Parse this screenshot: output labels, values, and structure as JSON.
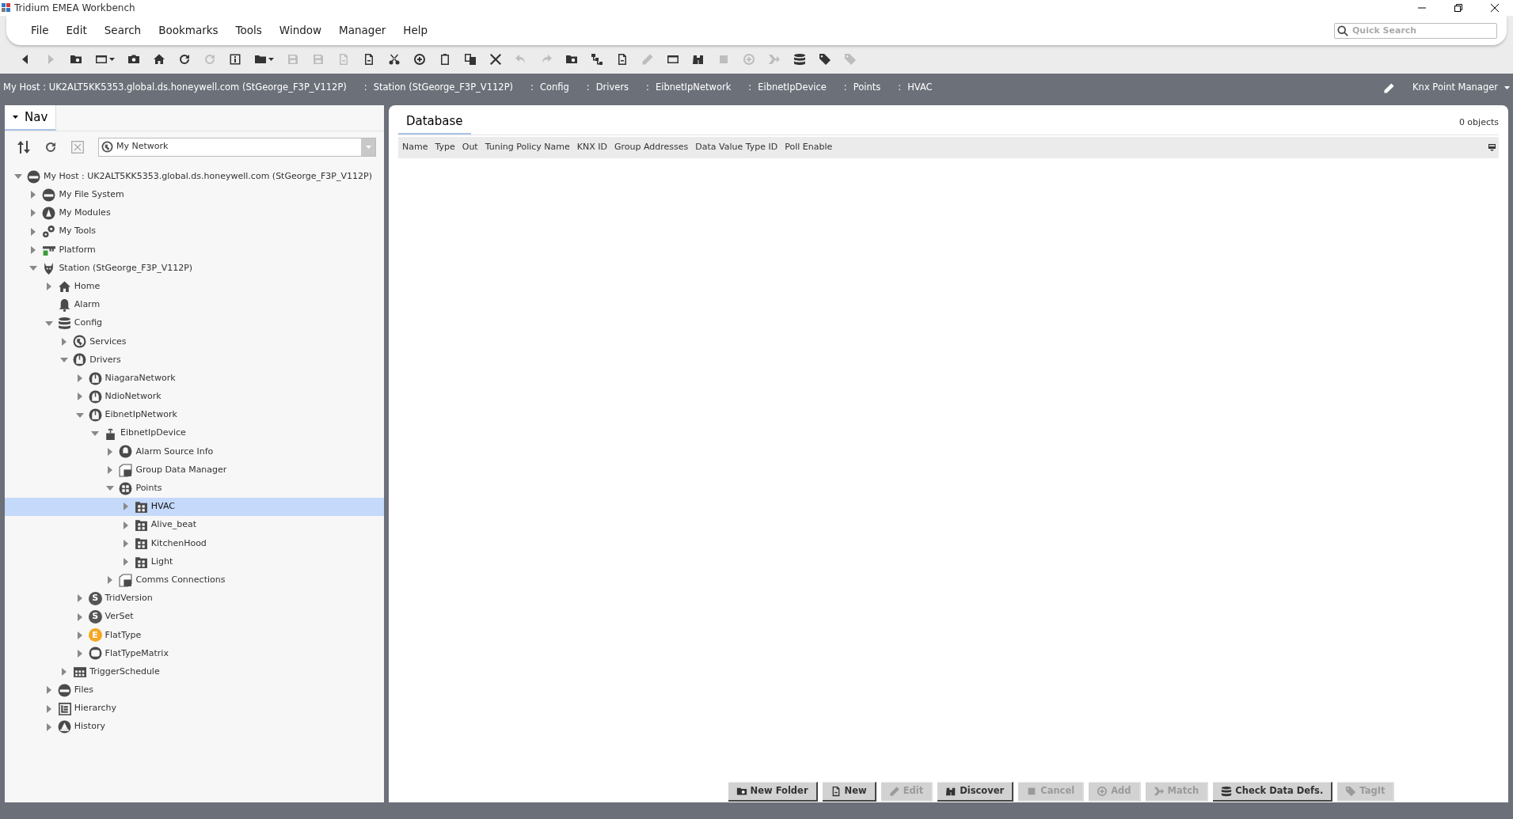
{
  "window": {
    "title": "Tridium EMEA Workbench"
  },
  "menu": [
    "File",
    "Edit",
    "Search",
    "Bookmarks",
    "Tools",
    "Window",
    "Manager",
    "Help"
  ],
  "quick_search": {
    "placeholder": "Quick Search"
  },
  "toolbar": [
    {
      "kind": "back",
      "disabled": false
    },
    {
      "kind": "forward",
      "disabled": true
    },
    {
      "kind": "folderup",
      "disabled": false
    },
    {
      "kind": "window",
      "disabled": false,
      "dropdown": true
    },
    {
      "kind": "camera",
      "disabled": false
    },
    {
      "kind": "home",
      "disabled": false
    },
    {
      "kind": "refresh",
      "disabled": false
    },
    {
      "kind": "refresh",
      "disabled": true
    },
    {
      "kind": "info",
      "disabled": false
    },
    {
      "kind": "folder",
      "disabled": false,
      "dropdown": true
    },
    {
      "kind": "save",
      "disabled": true
    },
    {
      "kind": "save",
      "disabled": true
    },
    {
      "kind": "doc",
      "disabled": true
    },
    {
      "kind": "doc",
      "disabled": false
    },
    {
      "kind": "cut",
      "disabled": false
    },
    {
      "kind": "addcircle",
      "disabled": false
    },
    {
      "kind": "clipboard",
      "disabled": false
    },
    {
      "kind": "copy",
      "disabled": false
    },
    {
      "kind": "delete",
      "disabled": false
    },
    {
      "kind": "undo",
      "disabled": true
    },
    {
      "kind": "redo",
      "disabled": true
    },
    {
      "kind": "folderup",
      "disabled": false
    },
    {
      "kind": "tree",
      "disabled": false
    },
    {
      "kind": "doc",
      "disabled": false
    },
    {
      "kind": "pencil",
      "disabled": true
    },
    {
      "kind": "window",
      "disabled": false
    },
    {
      "kind": "binoculars",
      "disabled": false
    },
    {
      "kind": "stop",
      "disabled": true
    },
    {
      "kind": "addcircle",
      "disabled": true
    },
    {
      "kind": "match",
      "disabled": true
    },
    {
      "kind": "database",
      "disabled": false
    },
    {
      "kind": "tag",
      "disabled": false
    },
    {
      "kind": "tag",
      "disabled": true
    }
  ],
  "breadcrumb": {
    "separator": ":",
    "items": [
      "My Host : UK2ALT5KK5353.global.ds.honeywell.com (StGeorge_F3P_V112P)",
      "Station (StGeorge_F3P_V112P)",
      "Config",
      "Drivers",
      "EibnetIpNetwork",
      "EibnetIpDevice",
      "Points",
      "HVAC"
    ],
    "view": "Knx Point Manager"
  },
  "nav": {
    "tab": "Nav",
    "dropdown": "My Network",
    "tree": [
      {
        "label": "My Host : UK2ALT5KK5353.global.ds.honeywell.com (StGeorge_F3P_V112P)",
        "kind": "drive",
        "expanded": true,
        "selected": false,
        "children": [
          {
            "label": "My File System",
            "kind": "drive",
            "expanded": false,
            "selected": false
          },
          {
            "label": "My Modules",
            "kind": "module",
            "expanded": false,
            "selected": false
          },
          {
            "label": "My Tools",
            "kind": "gears",
            "expanded": false,
            "selected": false
          },
          {
            "label": "Platform",
            "kind": "platform",
            "expanded": false,
            "selected": false
          },
          {
            "label": "Station (StGeorge_F3P_V112P)",
            "kind": "station",
            "expanded": true,
            "selected": false,
            "children": [
              {
                "label": "Home",
                "kind": "home",
                "expanded": false,
                "selected": false
              },
              {
                "label": "Alarm",
                "kind": "bell",
                "selected": false,
                "leaf": true
              },
              {
                "label": "Config",
                "kind": "database",
                "expanded": true,
                "selected": false,
                "children": [
                  {
                    "label": "Services",
                    "kind": "globe",
                    "expanded": false,
                    "selected": false
                  },
                  {
                    "label": "Drivers",
                    "kind": "driver",
                    "expanded": true,
                    "selected": false,
                    "children": [
                      {
                        "label": "NiagaraNetwork",
                        "kind": "driver",
                        "expanded": false,
                        "selected": false
                      },
                      {
                        "label": "NdioNetwork",
                        "kind": "driver",
                        "expanded": false,
                        "selected": false
                      },
                      {
                        "label": "EibnetIpNetwork",
                        "kind": "driver",
                        "expanded": true,
                        "selected": false,
                        "children": [
                          {
                            "label": "EibnetIpDevice",
                            "kind": "device",
                            "expanded": true,
                            "selected": false,
                            "children": [
                              {
                                "label": "Alarm Source Info",
                                "kind": "alarmsource",
                                "expanded": false,
                                "selected": false
                              },
                              {
                                "label": "Group Data Manager",
                                "kind": "cube",
                                "expanded": false,
                                "selected": false
                              },
                              {
                                "label": "Points",
                                "kind": "points",
                                "expanded": true,
                                "selected": false,
                                "children": [
                                  {
                                    "label": "HVAC",
                                    "kind": "grid",
                                    "expanded": false,
                                    "selected": true
                                  },
                                  {
                                    "label": "Alive_beat",
                                    "kind": "grid",
                                    "expanded": false,
                                    "selected": false
                                  },
                                  {
                                    "label": "KitchenHood",
                                    "kind": "grid",
                                    "expanded": false,
                                    "selected": false
                                  },
                                  {
                                    "label": "Light",
                                    "kind": "grid",
                                    "expanded": false,
                                    "selected": false
                                  }
                                ]
                              },
                              {
                                "label": "Comms Connections",
                                "kind": "cube",
                                "expanded": false,
                                "selected": false
                              }
                            ]
                          }
                        ]
                      },
                      {
                        "label": "TridVersion",
                        "kind": "letter",
                        "letter": "S",
                        "color": "#555555",
                        "expanded": false,
                        "selected": false
                      },
                      {
                        "label": "VerSet",
                        "kind": "letter",
                        "letter": "S",
                        "color": "#555555",
                        "expanded": false,
                        "selected": false
                      },
                      {
                        "label": "FlatType",
                        "kind": "letter",
                        "letter": "E",
                        "color": "#f5a623",
                        "expanded": false,
                        "selected": false
                      },
                      {
                        "label": "FlatTypeMatrix",
                        "kind": "ring",
                        "expanded": false,
                        "selected": false
                      }
                    ]
                  },
                  {
                    "label": "TriggerSchedule",
                    "kind": "schedule",
                    "expanded": false,
                    "selected": false
                  }
                ]
              },
              {
                "label": "Files",
                "kind": "drive",
                "expanded": false,
                "selected": false
              },
              {
                "label": "Hierarchy",
                "kind": "hierarchy",
                "expanded": false,
                "selected": false
              },
              {
                "label": "History",
                "kind": "history",
                "expanded": false,
                "selected": false
              }
            ]
          }
        ]
      }
    ]
  },
  "database": {
    "tab": "Database",
    "count": "0 objects",
    "columns": [
      "Name",
      "Type",
      "Out",
      "Tuning Policy Name",
      "KNX ID",
      "Group Addresses",
      "Data Value Type ID",
      "Poll Enable"
    ]
  },
  "buttons": [
    {
      "label": "New Folder",
      "kind": "folderup",
      "disabled": false
    },
    {
      "label": "New",
      "kind": "doc",
      "disabled": false
    },
    {
      "label": "Edit",
      "kind": "pencil",
      "disabled": true
    },
    {
      "label": "Discover",
      "kind": "binoculars",
      "disabled": false
    },
    {
      "label": "Cancel",
      "kind": "stop",
      "disabled": true
    },
    {
      "label": "Add",
      "kind": "addcircle",
      "disabled": true
    },
    {
      "label": "Match",
      "kind": "match",
      "disabled": true
    },
    {
      "label": "Check Data Defs.",
      "kind": "database",
      "disabled": false
    },
    {
      "label": "TagIt",
      "kind": "tag",
      "disabled": true
    }
  ]
}
